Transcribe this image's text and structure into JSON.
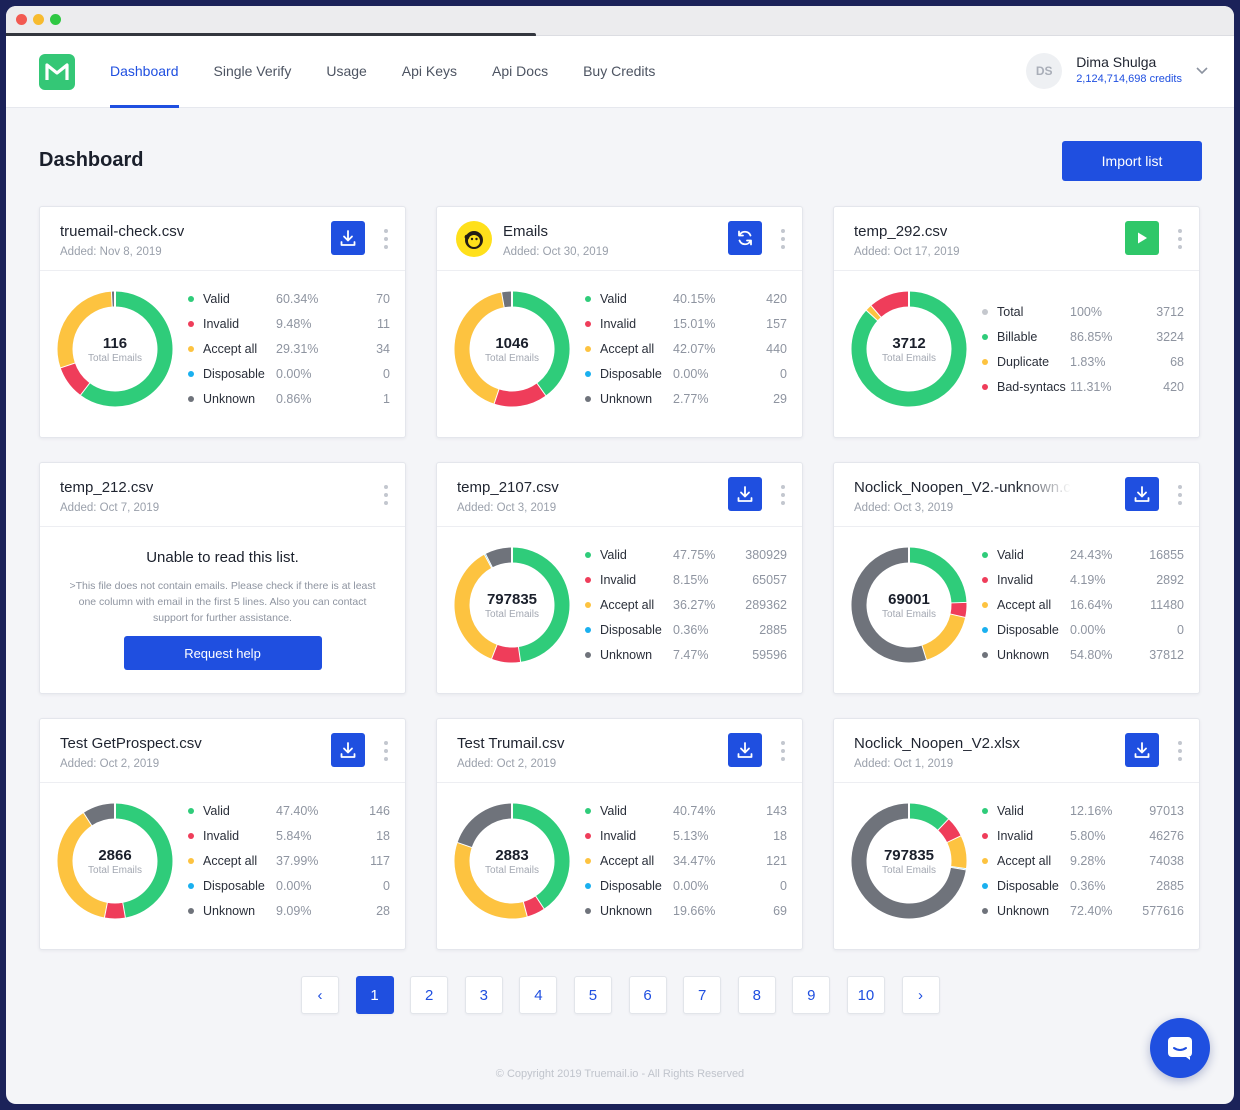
{
  "nav": {
    "links": [
      "Dashboard",
      "Single Verify",
      "Usage",
      "Api Keys",
      "Api Docs",
      "Buy Credits"
    ],
    "active": 0,
    "user": {
      "initials": "DS",
      "name": "Dima Shulga",
      "credits": "2,124,714,698 credits"
    }
  },
  "page": {
    "title": "Dashboard",
    "import_label": "Import list"
  },
  "colors": {
    "valid": "#2fcc7a",
    "invalid": "#ef3d5a",
    "accept_all": "#fdc340",
    "disposable": "#1ab0ef",
    "unknown": "#6f737b",
    "total": "#c5c8ce",
    "billable": "#2fcc7a",
    "duplicate": "#fdc340",
    "bad_syntax": "#ef3d5a"
  },
  "cards": [
    {
      "title": "truemail-check.csv",
      "date": "Added: Nov 8, 2019",
      "action": "download-icon",
      "total": "116",
      "total_label": "Total Emails",
      "stats": [
        {
          "label": "Valid",
          "pct": "60.34%",
          "count": "70",
          "color": "valid"
        },
        {
          "label": "Invalid",
          "pct": "9.48%",
          "count": "11",
          "color": "invalid"
        },
        {
          "label": "Accept all",
          "pct": "29.31%",
          "count": "34",
          "color": "accept_all"
        },
        {
          "label": "Disposable",
          "pct": "0.00%",
          "count": "0",
          "color": "disposable"
        },
        {
          "label": "Unknown",
          "pct": "0.86%",
          "count": "1",
          "color": "unknown"
        }
      ]
    },
    {
      "title": "Emails",
      "date": "Added: Oct 30, 2019",
      "action": "refresh-icon",
      "logo": "mailchimp-logo-icon",
      "total": "1046",
      "total_label": "Total Emails",
      "stats": [
        {
          "label": "Valid",
          "pct": "40.15%",
          "count": "420",
          "color": "valid"
        },
        {
          "label": "Invalid",
          "pct": "15.01%",
          "count": "157",
          "color": "invalid"
        },
        {
          "label": "Accept all",
          "pct": "42.07%",
          "count": "440",
          "color": "accept_all"
        },
        {
          "label": "Disposable",
          "pct": "0.00%",
          "count": "0",
          "color": "disposable"
        },
        {
          "label": "Unknown",
          "pct": "2.77%",
          "count": "29",
          "color": "unknown"
        }
      ]
    },
    {
      "title": "temp_292.csv",
      "date": "Added: Oct 17, 2019",
      "action": "play-icon",
      "total": "3712",
      "total_label": "Total Emails",
      "stats": [
        {
          "label": "Total",
          "pct": "100%",
          "count": "3712",
          "color": "total",
          "in_chart": false
        },
        {
          "label": "Billable",
          "pct": "86.85%",
          "count": "3224",
          "color": "billable"
        },
        {
          "label": "Duplicate",
          "pct": "1.83%",
          "count": "68",
          "color": "duplicate"
        },
        {
          "label": "Bad-syntacs",
          "pct": "11.31%",
          "count": "420",
          "color": "bad_syntax"
        }
      ]
    },
    {
      "title": "temp_212.csv",
      "date": "Added: Oct 7, 2019",
      "error": {
        "title": "Unable to read this list.",
        "message": ">This file does not contain emails. Please check if there is at least one column with email in the first 5 lines. Also you can contact support for further assistance.",
        "button": "Request help"
      }
    },
    {
      "title": "temp_2107.csv",
      "date": "Added: Oct 3, 2019",
      "action": "download-icon",
      "total": "797835",
      "total_label": "Total Emails",
      "stats": [
        {
          "label": "Valid",
          "pct": "47.75%",
          "count": "380929",
          "color": "valid"
        },
        {
          "label": "Invalid",
          "pct": "8.15%",
          "count": "65057",
          "color": "invalid"
        },
        {
          "label": "Accept all",
          "pct": "36.27%",
          "count": "289362",
          "color": "accept_all"
        },
        {
          "label": "Disposable",
          "pct": "0.36%",
          "count": "2885",
          "color": "disposable"
        },
        {
          "label": "Unknown",
          "pct": "7.47%",
          "count": "59596",
          "color": "unknown"
        }
      ]
    },
    {
      "title": "Noclick_Noopen_V2.-unknown.c",
      "date": "Added: Oct 3, 2019",
      "action": "download-icon",
      "faded": true,
      "total": "69001",
      "total_label": "Total Emails",
      "stats": [
        {
          "label": "Valid",
          "pct": "24.43%",
          "count": "16855",
          "color": "valid"
        },
        {
          "label": "Invalid",
          "pct": "4.19%",
          "count": "2892",
          "color": "invalid"
        },
        {
          "label": "Accept all",
          "pct": "16.64%",
          "count": "11480",
          "color": "accept_all"
        },
        {
          "label": "Disposable",
          "pct": "0.00%",
          "count": "0",
          "color": "disposable"
        },
        {
          "label": "Unknown",
          "pct": "54.80%",
          "count": "37812",
          "color": "unknown"
        }
      ]
    },
    {
      "title": "Test GetProspect.csv",
      "date": "Added: Oct 2, 2019",
      "action": "download-icon",
      "total": "2866",
      "total_label": "Total Emails",
      "stats": [
        {
          "label": "Valid",
          "pct": "47.40%",
          "count": "146",
          "color": "valid"
        },
        {
          "label": "Invalid",
          "pct": "5.84%",
          "count": "18",
          "color": "invalid"
        },
        {
          "label": "Accept all",
          "pct": "37.99%",
          "count": "117",
          "color": "accept_all"
        },
        {
          "label": "Disposable",
          "pct": "0.00%",
          "count": "0",
          "color": "disposable"
        },
        {
          "label": "Unknown",
          "pct": "9.09%",
          "count": "28",
          "color": "unknown"
        }
      ]
    },
    {
      "title": "Test Trumail.csv",
      "date": "Added: Oct 2, 2019",
      "action": "download-icon",
      "total": "2883",
      "total_label": "Total Emails",
      "stats": [
        {
          "label": "Valid",
          "pct": "40.74%",
          "count": "143",
          "color": "valid"
        },
        {
          "label": "Invalid",
          "pct": "5.13%",
          "count": "18",
          "color": "invalid"
        },
        {
          "label": "Accept all",
          "pct": "34.47%",
          "count": "121",
          "color": "accept_all"
        },
        {
          "label": "Disposable",
          "pct": "0.00%",
          "count": "0",
          "color": "disposable"
        },
        {
          "label": "Unknown",
          "pct": "19.66%",
          "count": "69",
          "color": "unknown"
        }
      ]
    },
    {
      "title": "Noclick_Noopen_V2.xlsx",
      "date": "Added: Oct 1, 2019",
      "action": "download-icon",
      "total": "797835",
      "total_label": "Total Emails",
      "stats": [
        {
          "label": "Valid",
          "pct": "12.16%",
          "count": "97013",
          "color": "valid"
        },
        {
          "label": "Invalid",
          "pct": "5.80%",
          "count": "46276",
          "color": "invalid"
        },
        {
          "label": "Accept all",
          "pct": "9.28%",
          "count": "74038",
          "color": "accept_all"
        },
        {
          "label": "Disposable",
          "pct": "0.36%",
          "count": "2885",
          "color": "disposable"
        },
        {
          "label": "Unknown",
          "pct": "72.40%",
          "count": "577616",
          "color": "unknown"
        }
      ]
    }
  ],
  "pagination": {
    "prev": "‹",
    "next": "›",
    "pages": [
      "1",
      "2",
      "3",
      "4",
      "5",
      "6",
      "7",
      "8",
      "9",
      "10"
    ],
    "active": 0
  },
  "footer": {
    "copyright": "© Copyright 2019 Truemail.io - All Rights Reserved"
  }
}
